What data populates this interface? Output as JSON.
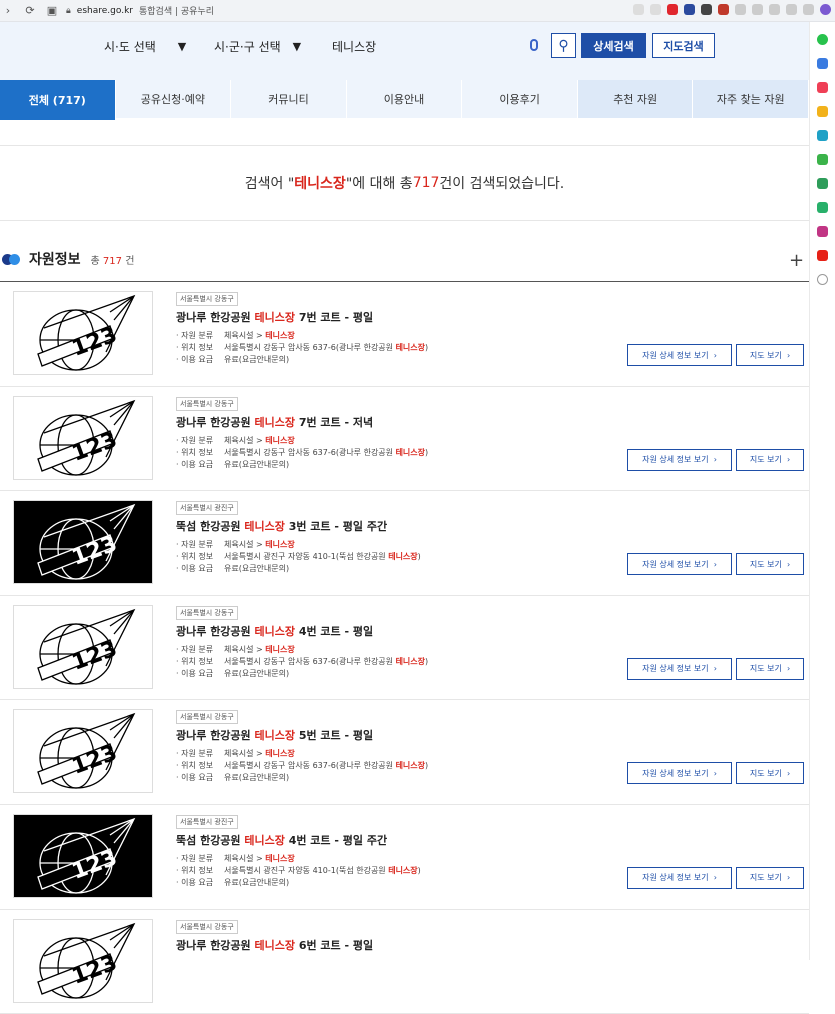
{
  "browser": {
    "url_domain": "eshare.go.kr",
    "tab_title": "통합검색 | 공유누리"
  },
  "search": {
    "sido_label": "시·도 선택",
    "sigungu_label": "시·군·구 선택",
    "query": "테니스장",
    "detail_btn": "상세검색",
    "map_btn": "지도검색"
  },
  "tabs": [
    {
      "label": "전체 (717)"
    },
    {
      "label": "공유신청·예약"
    },
    {
      "label": "커뮤니티"
    },
    {
      "label": "이용안내"
    },
    {
      "label": "이용후기"
    },
    {
      "label": "추천 자원"
    },
    {
      "label": "자주 찾는 자원"
    }
  ],
  "result": {
    "prefix": "검색어 \" ",
    "keyword": "테니스장",
    "middle": " \"에 대해 총 ",
    "count": "717",
    "suffix": " 건이 검색되었습니다."
  },
  "section": {
    "title": "자원정보",
    "count_prefix": "총 ",
    "count": "717",
    "count_suffix": " 건",
    "plus": "+"
  },
  "items": [
    {
      "region": "서울특별시 강동구",
      "title_pre": "광나루 한강공원 ",
      "kw": "테니스장",
      "title_post": " 7번 코트 - 평일",
      "cat_k": "· 자원 분류",
      "cat_v": "체육시설 > ",
      "loc_k": "· 위치 정보",
      "loc_v": "서울특별시 강동구 암사동 637-6(광나루 한강공원 ",
      "loc_end": ")",
      "fee_k": "· 이용 요금",
      "fee_v": "유료(요금안내문의)",
      "btn_detail": "자원 상세 정보 보기",
      "btn_map": "지도 보기",
      "dark": false
    },
    {
      "region": "서울특별시 강동구",
      "title_pre": "광나루 한강공원 ",
      "kw": "테니스장",
      "title_post": " 7번 코트 - 저녁",
      "cat_k": "· 자원 분류",
      "cat_v": "체육시설 > ",
      "loc_k": "· 위치 정보",
      "loc_v": "서울특별시 강동구 암사동 637-6(광나루 한강공원 ",
      "loc_end": ")",
      "fee_k": "· 이용 요금",
      "fee_v": "유료(요금안내문의)",
      "btn_detail": "자원 상세 정보 보기",
      "btn_map": "지도 보기",
      "dark": false
    },
    {
      "region": "서울특별시 광진구",
      "title_pre": "뚝섬 한강공원 ",
      "kw": "테니스장",
      "title_post": " 3번 코트 - 평일 주간",
      "cat_k": "· 자원 분류",
      "cat_v": "체육시설 > ",
      "loc_k": "· 위치 정보",
      "loc_v": "서울특별시 광진구 자양동 410-1(뚝섬 한강공원 ",
      "loc_end": ")",
      "fee_k": "· 이용 요금",
      "fee_v": "유료(요금안내문의)",
      "btn_detail": "자원 상세 정보 보기",
      "btn_map": "지도 보기",
      "dark": true
    },
    {
      "region": "서울특별시 강동구",
      "title_pre": "광나루 한강공원 ",
      "kw": "테니스장",
      "title_post": " 4번 코트 - 평일",
      "cat_k": "· 자원 분류",
      "cat_v": "체육시설 > ",
      "loc_k": "· 위치 정보",
      "loc_v": "서울특별시 강동구 암사동 637-6(광나루 한강공원 ",
      "loc_end": ")",
      "fee_k": "· 이용 요금",
      "fee_v": "유료(요금안내문의)",
      "btn_detail": "자원 상세 정보 보기",
      "btn_map": "지도 보기",
      "dark": false
    },
    {
      "region": "서울특별시 강동구",
      "title_pre": "광나루 한강공원 ",
      "kw": "테니스장",
      "title_post": " 5번 코트 - 평일",
      "cat_k": "· 자원 분류",
      "cat_v": "체육시설 > ",
      "loc_k": "· 위치 정보",
      "loc_v": "서울특별시 강동구 암사동 637-6(광나루 한강공원 ",
      "loc_end": ")",
      "fee_k": "· 이용 요금",
      "fee_v": "유료(요금안내문의)",
      "btn_detail": "자원 상세 정보 보기",
      "btn_map": "지도 보기",
      "dark": false
    },
    {
      "region": "서울특별시 광진구",
      "title_pre": "뚝섬 한강공원 ",
      "kw": "테니스장",
      "title_post": " 4번 코트 - 평일 주간",
      "cat_k": "· 자원 분류",
      "cat_v": "체육시설 > ",
      "loc_k": "· 위치 정보",
      "loc_v": "서울특별시 광진구 자양동 410-1(뚝섬 한강공원 ",
      "loc_end": ")",
      "fee_k": "· 이용 요금",
      "fee_v": "유료(요금안내문의)",
      "btn_detail": "자원 상세 정보 보기",
      "btn_map": "지도 보기",
      "dark": true
    },
    {
      "region": "서울특별시 강동구",
      "title_pre": "광나루 한강공원 ",
      "kw": "테니스장",
      "title_post": " 6번 코트 - 평일",
      "cat_k": "",
      "cat_v": "",
      "loc_k": "",
      "loc_v": "",
      "loc_end": "",
      "fee_k": "",
      "fee_v": "",
      "btn_detail": "",
      "btn_map": "",
      "dark": false
    }
  ],
  "thumb_text": "123",
  "colors": {
    "brand": "#1e4ea7",
    "tab_active": "#1e70c8",
    "highlight": "#d9261c"
  }
}
